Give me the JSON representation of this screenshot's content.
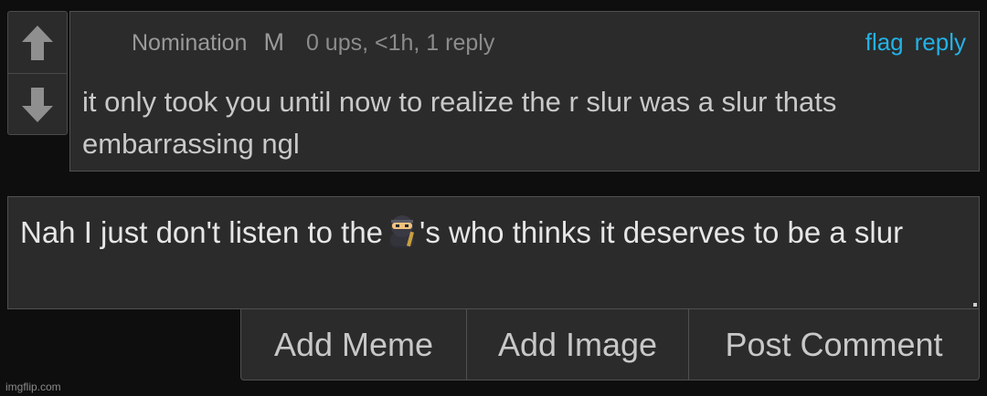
{
  "vote": {
    "up_icon": "arrow-up-icon",
    "down_icon": "arrow-down-icon"
  },
  "comment": {
    "author": "Nomination",
    "badge": "M",
    "stats": "0 ups, <1h, 1 reply",
    "flag_label": "flag",
    "reply_label": "reply",
    "text": "it only took you until now to realize the r slur was a slur thats embarrassing ngl"
  },
  "reply_box": {
    "text_before": "Nah I just don't listen to the",
    "emoji": "ninja-emoji",
    "text_after": "'s who thinks it deserves to be a slur"
  },
  "buttons": {
    "add_meme": "Add Meme",
    "add_image": "Add Image",
    "post_comment": "Post Comment"
  },
  "watermark": "imgflip.com",
  "colors": {
    "background": "#0e0e0e",
    "panel": "#2b2b2b",
    "link": "#23b2e6",
    "vote_arrow": "#8f8f8f"
  }
}
